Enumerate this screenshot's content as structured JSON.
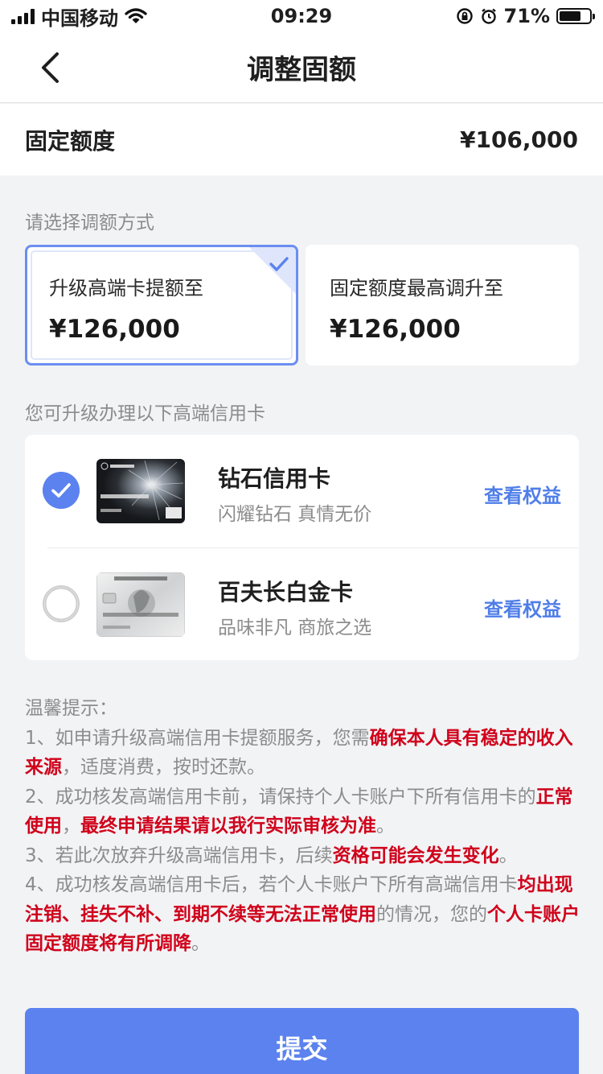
{
  "status_bar": {
    "carrier": "中国移动",
    "time": "09:29",
    "battery_percent": "71%",
    "battery_level": 0.71
  },
  "nav": {
    "title": "调整固额"
  },
  "fixed_amount": {
    "label": "固定额度",
    "value": "¥106,000"
  },
  "method_section": {
    "label": "请选择调额方式",
    "options": [
      {
        "title": "升级高端卡提额至",
        "amount": "¥126,000",
        "selected": true
      },
      {
        "title": "固定额度最高调升至",
        "amount": "¥126,000",
        "selected": false
      }
    ]
  },
  "cards_section": {
    "label": "您可升级办理以下高端信用卡",
    "cards": [
      {
        "name": "钻石信用卡",
        "desc": "闪耀钻石 真情无价",
        "link": "查看权益",
        "selected": true,
        "image": "diamond-card-image"
      },
      {
        "name": "百夫长白金卡",
        "desc": "品味非凡 商旅之选",
        "link": "查看权益",
        "selected": false,
        "image": "amex-platinum-card-image"
      }
    ]
  },
  "tips": {
    "title": "温馨提示：",
    "t1_a": "1、如申请升级高端信用卡提额服务，您需",
    "t1_b": "确保本人具有稳定的收入来源",
    "t1_c": "，适度消费，按时还款。",
    "t2_a": "2、成功核发高端信用卡前，请保持个人卡账户下所有信用卡的",
    "t2_b": "正常使用",
    "t2_c": "，",
    "t2_d": "最终申请结果请以我行实际审核为准",
    "t2_e": "。",
    "t3_a": "3、若此次放弃升级高端信用卡，后续",
    "t3_b": "资格可能会发生变化",
    "t3_c": "。",
    "t4_a": "4、成功核发高端信用卡后，若个人卡账户下所有高端信用卡",
    "t4_b": "均出现注销、挂失不补、到期不续等无法正常使用",
    "t4_c": "的情况，您的",
    "t4_d": "个人卡账户固定额度将有所调降",
    "t4_e": "。"
  },
  "submit": {
    "label": "提交"
  },
  "colors": {
    "accent": "#5b82ee",
    "link": "#4f7ee8",
    "highlight": "#d0021b"
  }
}
